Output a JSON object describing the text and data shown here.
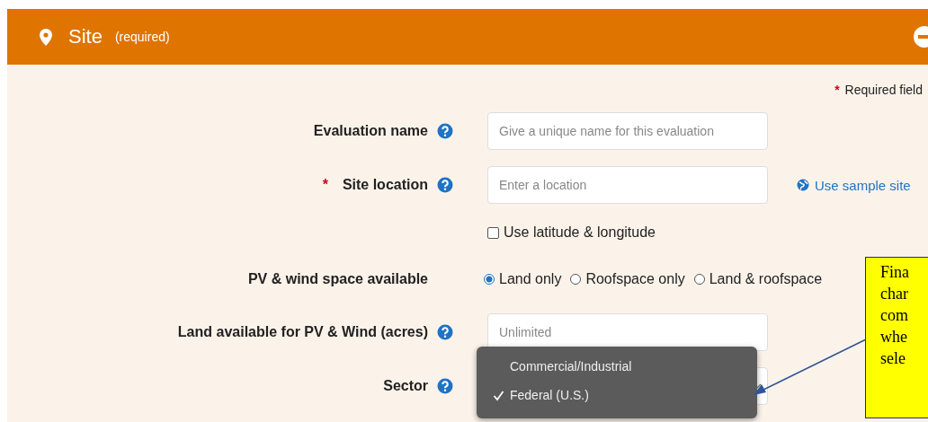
{
  "header": {
    "title": "Site",
    "subtitle": "(required)"
  },
  "required_note": {
    "mark": "*",
    "text": "Required field"
  },
  "rows": [
    {
      "kind": "text",
      "label": "Evaluation name",
      "required": false,
      "help": true,
      "placeholder": "Give a unique name for this evaluation"
    },
    {
      "kind": "text",
      "label": "Site location",
      "required": true,
      "help": true,
      "placeholder": "Enter a location",
      "link": "Use sample site"
    },
    {
      "kind": "checkbox",
      "text": "Use latitude & longitude",
      "checked": false
    },
    {
      "kind": "radio",
      "label": "PV & wind space available",
      "required": false,
      "help": false,
      "options": [
        {
          "text": "Land only",
          "selected": true
        },
        {
          "text": "Roofspace only",
          "selected": false
        },
        {
          "text": "Land & roofspace",
          "selected": false
        }
      ]
    },
    {
      "kind": "text",
      "label": "Land available for PV & Wind (acres)",
      "required": false,
      "help": true,
      "placeholder": "Unlimited"
    },
    {
      "kind": "select",
      "label": "Sector",
      "required": false,
      "help": true
    }
  ],
  "dropdown": {
    "options": [
      {
        "text": "Commercial/Industrial",
        "selected": false
      },
      {
        "text": "Federal (U.S.)",
        "selected": true
      }
    ]
  },
  "callout": {
    "lines": [
      "Fina",
      "char",
      "com",
      "whe",
      "sele"
    ]
  }
}
